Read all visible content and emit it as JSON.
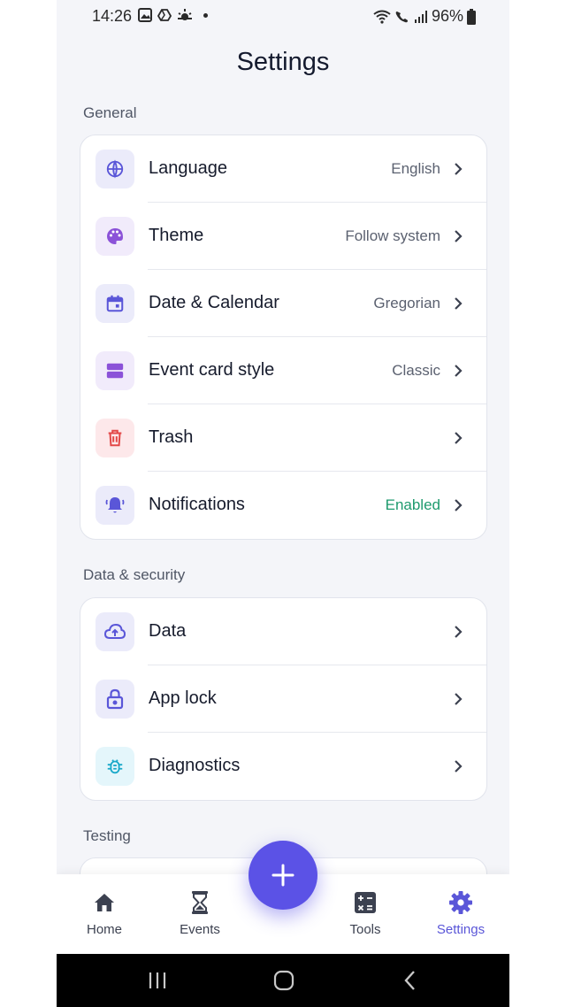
{
  "status_bar": {
    "time": "14:26",
    "battery": "96%"
  },
  "page_title": "Settings",
  "sections": {
    "general": {
      "label": "General",
      "items": [
        {
          "label": "Language",
          "value": "English",
          "icon": "globe-icon",
          "icon_bg": "#ebebfa",
          "icon_color": "#5a56d8"
        },
        {
          "label": "Theme",
          "value": "Follow system",
          "icon": "palette-icon",
          "icon_bg": "#f1ebfb",
          "icon_color": "#8b52d8"
        },
        {
          "label": "Date & Calendar",
          "value": "Gregorian",
          "icon": "calendar-icon",
          "icon_bg": "#ebebfa",
          "icon_color": "#5a56d8"
        },
        {
          "label": "Event card style",
          "value": "Classic",
          "icon": "card-style-icon",
          "icon_bg": "#f1ebfb",
          "icon_color": "#8b52d8"
        },
        {
          "label": "Trash",
          "value": "",
          "icon": "trash-icon",
          "icon_bg": "#fde8ea",
          "icon_color": "#e34848"
        },
        {
          "label": "Notifications",
          "value": "Enabled",
          "icon": "bell-icon",
          "icon_bg": "#ebebfa",
          "icon_color": "#5a56d8"
        }
      ]
    },
    "data_security": {
      "label": "Data & security",
      "items": [
        {
          "label": "Data",
          "value": "",
          "icon": "cloud-upload-icon",
          "icon_bg": "#ebebfa",
          "icon_color": "#5a56d8"
        },
        {
          "label": "App lock",
          "value": "",
          "icon": "lock-icon",
          "icon_bg": "#ebebfa",
          "icon_color": "#5a56d8"
        },
        {
          "label": "Diagnostics",
          "value": "",
          "icon": "bug-icon",
          "icon_bg": "#e4f6fb",
          "icon_color": "#1aa9c9"
        }
      ]
    },
    "testing": {
      "label": "Testing"
    }
  },
  "bottom_nav": {
    "items": [
      {
        "label": "Home",
        "icon": "home-icon"
      },
      {
        "label": "Events",
        "icon": "hourglass-icon"
      },
      {
        "label": "Tools",
        "icon": "calculator-icon"
      },
      {
        "label": "Settings",
        "icon": "gear-icon",
        "active": true
      }
    ]
  },
  "colors": {
    "accent": "#5b52e6",
    "enabled_green": "#1e9a6e"
  }
}
